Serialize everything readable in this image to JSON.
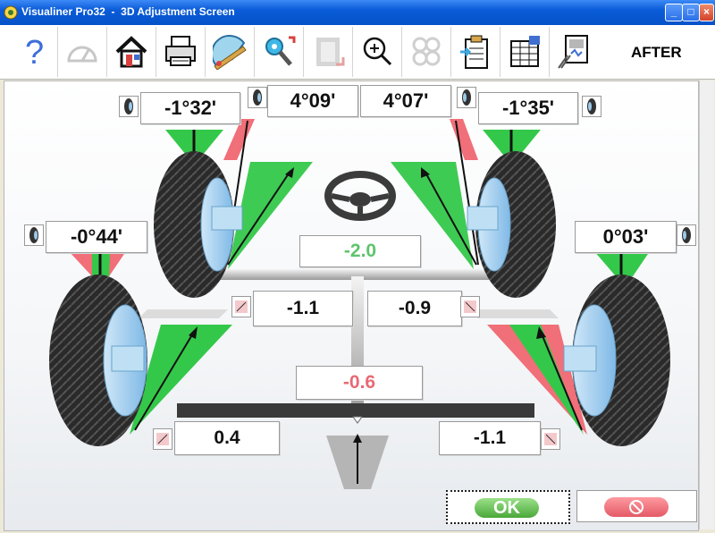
{
  "window": {
    "title": "Visualiner Pro32  -  3D Adjustment Screen",
    "minimize": "_",
    "maximize": "□",
    "close": "×"
  },
  "toolbar": {
    "tools": [
      {
        "icon": "help-icon"
      },
      {
        "icon": "gauge-icon"
      },
      {
        "icon": "home-icon"
      },
      {
        "icon": "printer-icon"
      },
      {
        "icon": "protractor-icon"
      },
      {
        "icon": "wrench-icon"
      },
      {
        "icon": "film-icon"
      },
      {
        "icon": "zoom-icon"
      },
      {
        "icon": "pattern-icon"
      },
      {
        "icon": "clipboard-icon"
      },
      {
        "icon": "spreadsheet-icon"
      },
      {
        "icon": "report-icon"
      }
    ],
    "mode_label": "AFTER"
  },
  "readings": {
    "left_front_camber": "-1°32'",
    "left_front_caster": "4°09'",
    "right_front_caster": "4°07'",
    "right_front_camber": "-1°35'",
    "left_rear_camber": "-0°44'",
    "right_rear_camber": "0°03'",
    "steering_wheel": "-2.0",
    "left_front_toe": "-1.1",
    "right_front_toe": "-0.9",
    "thrust_angle": "-0.6",
    "left_rear_toe": "0.4",
    "right_rear_toe": "-1.1"
  },
  "colors": {
    "in_spec": "#36c84a",
    "out_of_spec": "#f06f78",
    "steering_value": "#5ec46c",
    "thrust_value": "#e86a74"
  },
  "buttons": {
    "ok_label": "OK"
  }
}
